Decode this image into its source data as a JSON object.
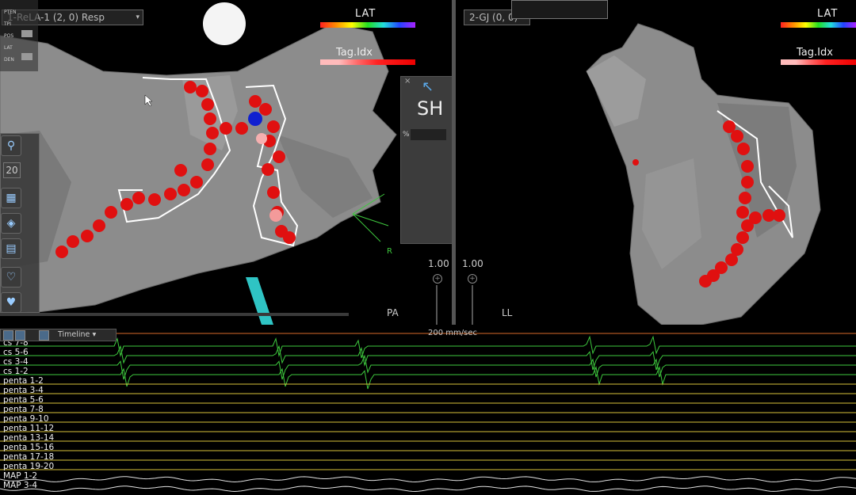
{
  "left_view": {
    "title": "1-ReLA-1 (2, 0) Resp",
    "lat_label": "LAT",
    "tag_label": "Tag.Idx",
    "side_labels": [
      "PTEN",
      "TPI",
      "POS",
      "LAT",
      "DEN"
    ],
    "zoom_value": "20",
    "sh_label": "SH",
    "percent_label": "%",
    "orientation_label": "R",
    "scale_value": "1.00",
    "pa_label": "PA"
  },
  "right_view": {
    "title": "2-GJ (0, 0)",
    "lat_label": "LAT",
    "tag_label": "Tag.Idx",
    "scale_value": "1.00",
    "ll_label": "LL"
  },
  "waveform": {
    "speed_label": "200 mm/sec",
    "timeline_label": "Timeline",
    "channels": [
      {
        "name": "cs 7-8",
        "color": "#3ec93e"
      },
      {
        "name": "cs 5-6",
        "color": "#3ec93e"
      },
      {
        "name": "cs 3-4",
        "color": "#3ec93e"
      },
      {
        "name": "cs 1-2",
        "color": "#3ec93e"
      },
      {
        "name": "penta 1-2",
        "color": "#d8c23a"
      },
      {
        "name": "penta 3-4",
        "color": "#d8c23a"
      },
      {
        "name": "penta 5-6",
        "color": "#d8c23a"
      },
      {
        "name": "penta 7-8",
        "color": "#d8c23a"
      },
      {
        "name": "penta 9-10",
        "color": "#d8c23a"
      },
      {
        "name": "penta 11-12",
        "color": "#d8c23a"
      },
      {
        "name": "penta 13-14",
        "color": "#d8c23a"
      },
      {
        "name": "penta 15-16",
        "color": "#d8c23a"
      },
      {
        "name": "penta 17-18",
        "color": "#d8c23a"
      },
      {
        "name": "penta 19-20",
        "color": "#d8c23a"
      },
      {
        "name": "MAP 1-2",
        "color": "#e0e0e0"
      },
      {
        "name": "MAP 3-4",
        "color": "#e0e0e0"
      }
    ]
  },
  "colors": {
    "ablation": "#e01010",
    "mesh": "#8a8a8a",
    "cs": "#3ec93e",
    "penta": "#d8c23a",
    "map": "#e0e0e0",
    "ref": "#d96a2a"
  }
}
